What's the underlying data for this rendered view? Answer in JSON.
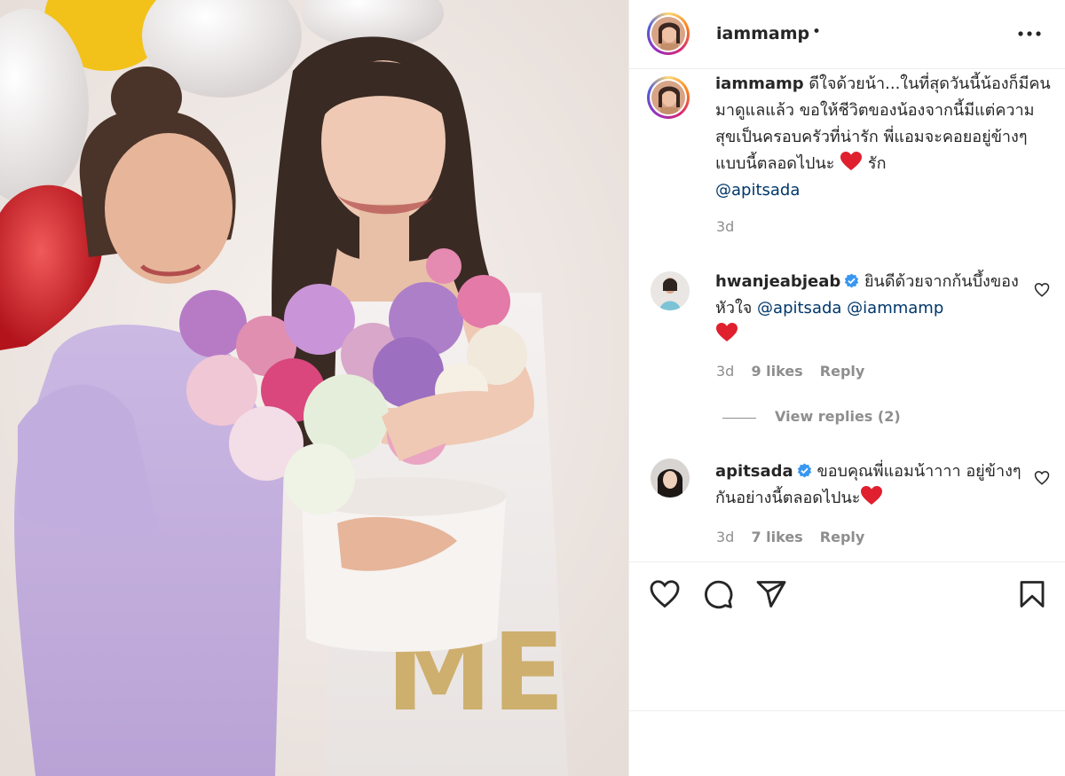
{
  "post": {
    "username": "iammamp",
    "header_dot": "•",
    "photo_alt": "Two women holding a bouquet of pink and purple flowers"
  },
  "caption": {
    "username": "iammamp",
    "text": "ดีใจด้วยน้า...ในที่สุดวันนี้น้องก็มีคนมาดูแลแล้ว ขอให้ชีวิตของน้องจากนี้มีแต่ความสุขเป็นครอบครัวที่น่ารัก พี่แอมจะคอยอยู่ข้างๆแบบนี้ตลอดไปนะ",
    "after_heart": "รัก",
    "mention": "@apitsada",
    "time": "3d"
  },
  "comments": [
    {
      "username": "hwanjeabjeab",
      "text": "ยินดีด้วยจากก้นบึ้งของหัวใจ",
      "mentions": [
        "@apitsada",
        "@iammamp"
      ],
      "time": "3d",
      "likes": "9 likes",
      "reply": "Reply"
    },
    {
      "username": "apitsada",
      "text": "ขอบคุณพี่แอมน้าาาา อยู่ข้างๆกันอย่างนี้ตลอดไปนะ",
      "time": "3d",
      "likes": "7 likes",
      "reply": "Reply"
    }
  ],
  "view_replies": "View replies (2)",
  "icons": {
    "more": "more-options-icon",
    "verified": "verified-badge-icon",
    "like": "heart-icon",
    "comment": "comment-icon",
    "share": "share-icon",
    "save": "bookmark-icon"
  },
  "colors": {
    "text": "#262626",
    "secondary": "#8e8e8e",
    "mention": "#00376b",
    "verified": "#3897f0",
    "heart_red": "#ed4956"
  }
}
